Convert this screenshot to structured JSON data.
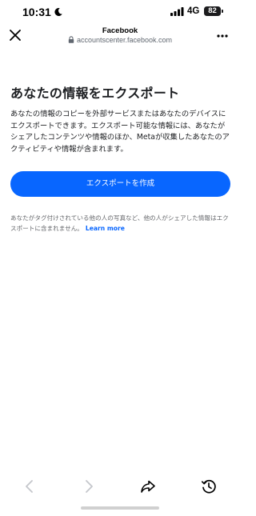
{
  "status_bar": {
    "time": "10:31",
    "network": "4G",
    "battery": "82"
  },
  "browser": {
    "site_title": "Facebook",
    "url": "accountscenter.facebook.com"
  },
  "page": {
    "title": "あなたの情報をエクスポート",
    "description": "あなたの情報のコピーを外部サービスまたはあなたのデバイスにエクスポートできます。エクスポート可能な情報には、あなたがシェアしたコンテンツや情報のほか、Metaが収集したあなたのアクティビティや情報が含まれます。",
    "export_button_label": "エクスポートを作成",
    "note": "あなたがタグ付けされている他の人の写真など、他の人がシェアした情報はエクスポートに含まれません。",
    "learn_more_label": "Learn more"
  },
  "colors": {
    "accent": "#0866ff",
    "text_primary": "#1c1e21",
    "text_secondary": "#65676b"
  },
  "icons": {
    "status": [
      "moon-icon",
      "signal-icon"
    ],
    "header": [
      "close-icon",
      "lock-icon",
      "more-icon"
    ],
    "toolbar": [
      "back-icon",
      "forward-icon",
      "share-icon",
      "history-icon"
    ]
  }
}
